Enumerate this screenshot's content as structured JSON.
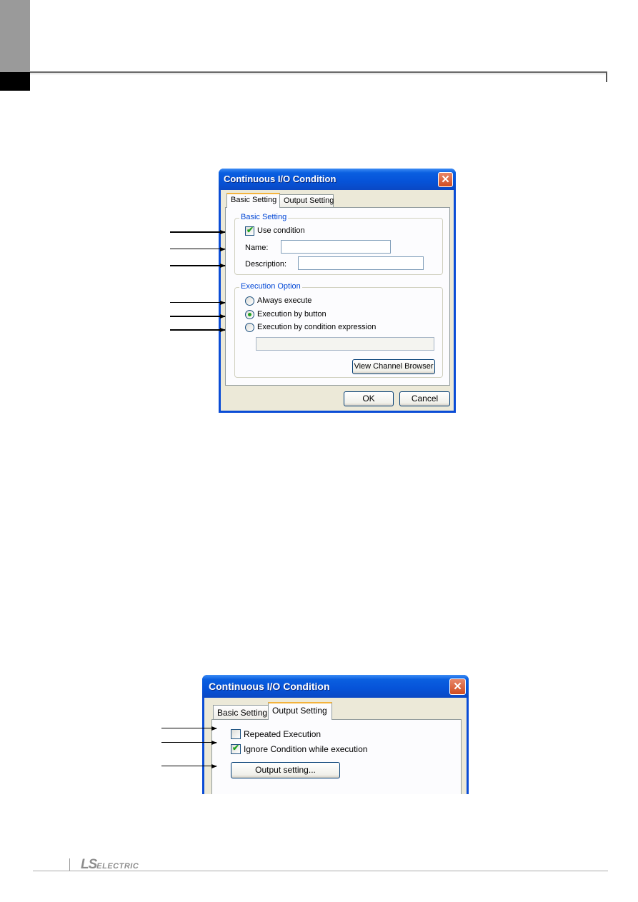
{
  "page": {
    "footer_logo": {
      "mark": "LS",
      "text": "ELECTRIC"
    }
  },
  "dialog1": {
    "title": "Continuous I/O Condition",
    "close_icon": "✕",
    "tabs": [
      {
        "label": "Basic Setting",
        "active": true
      },
      {
        "label": "Output Setting",
        "active": false
      }
    ],
    "basic_group": {
      "legend": "Basic Setting",
      "use_condition": {
        "label": "Use condition",
        "checked": true
      },
      "name": {
        "label": "Name:",
        "value": ""
      },
      "description": {
        "label": "Description:",
        "value": ""
      }
    },
    "execution_group": {
      "legend": "Execution Option",
      "options": [
        {
          "label": "Always execute",
          "selected": false
        },
        {
          "label": "Execution by button",
          "selected": true
        },
        {
          "label": "Execution by condition expression",
          "selected": false
        }
      ],
      "expression_value": "",
      "view_channel_browser": "View Channel Browser"
    },
    "ok": "OK",
    "cancel": "Cancel"
  },
  "dialog2": {
    "title": "Continuous I/O Condition",
    "close_icon": "✕",
    "tabs": [
      {
        "label": "Basic Setting",
        "active": false
      },
      {
        "label": "Output Setting",
        "active": true
      }
    ],
    "repeated_execution": {
      "label": "Repeated Execution",
      "checked": false
    },
    "ignore_condition": {
      "label": "Ignore Condition while execution",
      "checked": true
    },
    "output_setting_button": "Output setting..."
  }
}
